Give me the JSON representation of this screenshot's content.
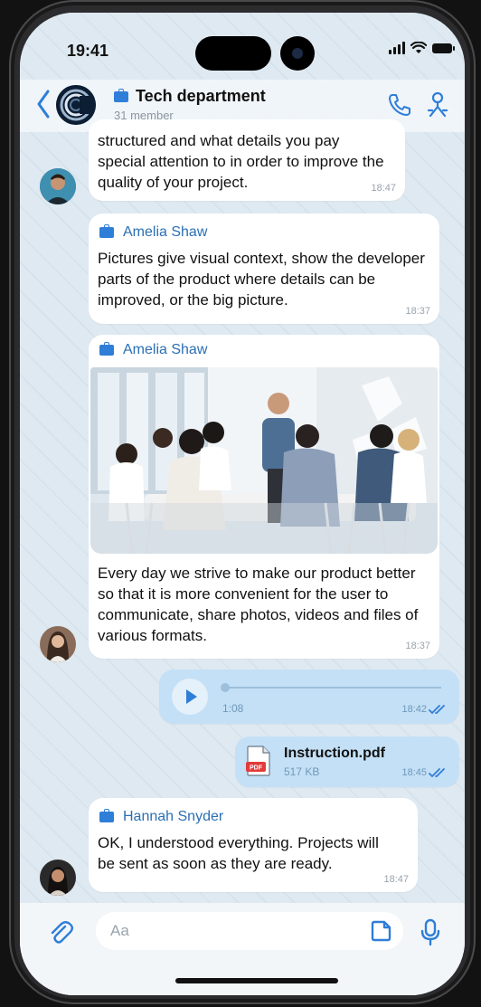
{
  "status_bar": {
    "time": "19:41"
  },
  "header": {
    "title": "Tech department",
    "subtitle": "31 member"
  },
  "messages": [
    {
      "text": "structured and what details you pay special attention to in order to improve the quality of your project.",
      "time": "18:47"
    },
    {
      "sender": "Amelia Shaw",
      "text": "Pictures give visual context, show the developer parts of the product where details can be improved, or the big picture.",
      "time": "18:37"
    },
    {
      "sender": "Amelia Shaw",
      "text": "Every day we strive to make our product better so that it is more convenient for the user to communicate, share photos, videos and files of various formats.",
      "time": "18:37"
    },
    {
      "voice_duration": "1:08",
      "time": "18:42",
      "progress": 0.0
    },
    {
      "file_name": "Instruction.pdf",
      "file_size": "517 KB",
      "file_type": "PDF",
      "time": "18:45"
    },
    {
      "sender": "Hannah Snyder",
      "text": "OK, I understood everything. Projects will be sent as soon as they are ready.",
      "time": "18:47"
    }
  ],
  "composer": {
    "placeholder": "Aa"
  },
  "colors": {
    "accent": "#2f7ed8",
    "outgoing_bubble": "#c4e0f6",
    "incoming_bubble": "#ffffff",
    "sender_name": "#2b6fb3"
  }
}
